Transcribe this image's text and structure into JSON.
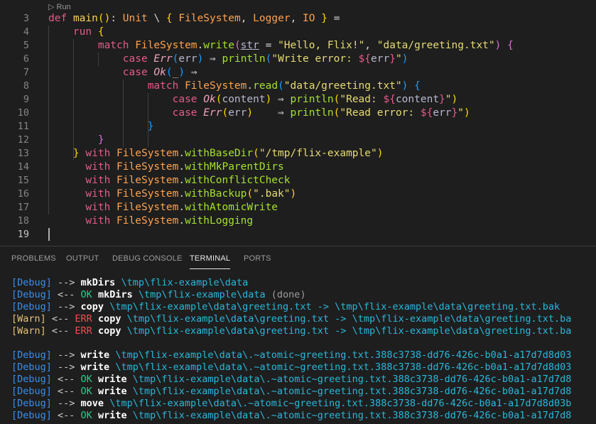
{
  "editor": {
    "codelens": "Run",
    "lines": [
      {
        "num": "3",
        "tokens": [
          [
            "def",
            "kw"
          ],
          [
            " ",
            "pl"
          ],
          [
            "main",
            "fn"
          ],
          [
            "()",
            "b1"
          ],
          [
            ": ",
            "pl"
          ],
          [
            "Unit",
            "ty"
          ],
          [
            " \\ ",
            "pl"
          ],
          [
            "{",
            "b1"
          ],
          [
            " ",
            "pl"
          ],
          [
            "FileSystem",
            "ty"
          ],
          [
            ", ",
            "pl"
          ],
          [
            "Logger",
            "ty"
          ],
          [
            ", ",
            "pl"
          ],
          [
            "IO",
            "ty"
          ],
          [
            " ",
            "pl"
          ],
          [
            "}",
            "b1"
          ],
          [
            " =",
            "pl"
          ]
        ]
      },
      {
        "num": "4",
        "tokens": [
          [
            "    ",
            "pl"
          ],
          [
            "run",
            "kw"
          ],
          [
            " ",
            "pl"
          ],
          [
            "{",
            "b1"
          ]
        ]
      },
      {
        "num": "5",
        "tokens": [
          [
            "        ",
            "pl"
          ],
          [
            "match",
            "kw"
          ],
          [
            " ",
            "pl"
          ],
          [
            "FileSystem",
            "ty"
          ],
          [
            ".",
            "pl"
          ],
          [
            "write",
            "md"
          ],
          [
            "(",
            "b2"
          ],
          [
            "str",
            "va ul"
          ],
          [
            " = ",
            "pl"
          ],
          [
            "\"Hello, Flix!\"",
            "st"
          ],
          [
            ", ",
            "pl"
          ],
          [
            "\"data/greeting.txt\"",
            "st"
          ],
          [
            ")",
            "b2"
          ],
          [
            " ",
            "pl"
          ],
          [
            "{",
            "b2"
          ]
        ]
      },
      {
        "num": "6",
        "tokens": [
          [
            "            ",
            "pl"
          ],
          [
            "case",
            "kw"
          ],
          [
            " ",
            "pl"
          ],
          [
            "Err",
            "en"
          ],
          [
            "(",
            "b3"
          ],
          [
            "err",
            "va"
          ],
          [
            ")",
            "b3"
          ],
          [
            " ⇒ ",
            "pl"
          ],
          [
            "println",
            "md"
          ],
          [
            "(",
            "b3"
          ],
          [
            "\"Write error: ",
            "st"
          ],
          [
            "${",
            "ip"
          ],
          [
            "err",
            "va"
          ],
          [
            "}",
            "ip"
          ],
          [
            "\"",
            "st"
          ],
          [
            ")",
            "b3"
          ]
        ]
      },
      {
        "num": "7",
        "tokens": [
          [
            "            ",
            "pl"
          ],
          [
            "case",
            "kw"
          ],
          [
            " ",
            "pl"
          ],
          [
            "Ok",
            "en"
          ],
          [
            "(",
            "b3"
          ],
          [
            "_",
            "va"
          ],
          [
            ")",
            "b3"
          ],
          [
            " ⇒",
            "pl"
          ]
        ]
      },
      {
        "num": "8",
        "tokens": [
          [
            "                ",
            "pl"
          ],
          [
            "match",
            "kw"
          ],
          [
            " ",
            "pl"
          ],
          [
            "FileSystem",
            "ty"
          ],
          [
            ".",
            "pl"
          ],
          [
            "read",
            "md"
          ],
          [
            "(",
            "b3"
          ],
          [
            "\"data/greeting.txt\"",
            "st"
          ],
          [
            ")",
            "b3"
          ],
          [
            " ",
            "pl"
          ],
          [
            "{",
            "b3"
          ]
        ]
      },
      {
        "num": "9",
        "tokens": [
          [
            "                    ",
            "pl"
          ],
          [
            "case",
            "kw"
          ],
          [
            " ",
            "pl"
          ],
          [
            "Ok",
            "en"
          ],
          [
            "(",
            "b1"
          ],
          [
            "content",
            "va"
          ],
          [
            ")",
            "b1"
          ],
          [
            " ⇒ ",
            "pl"
          ],
          [
            "println",
            "md"
          ],
          [
            "(",
            "b1"
          ],
          [
            "\"Read: ",
            "st"
          ],
          [
            "${",
            "ip"
          ],
          [
            "content",
            "va"
          ],
          [
            "}",
            "ip"
          ],
          [
            "\"",
            "st"
          ],
          [
            ")",
            "b1"
          ]
        ]
      },
      {
        "num": "10",
        "tokens": [
          [
            "                    ",
            "pl"
          ],
          [
            "case",
            "kw"
          ],
          [
            " ",
            "pl"
          ],
          [
            "Err",
            "en"
          ],
          [
            "(",
            "b1"
          ],
          [
            "err",
            "va"
          ],
          [
            ")",
            "b1"
          ],
          [
            "    ⇒ ",
            "pl"
          ],
          [
            "println",
            "md"
          ],
          [
            "(",
            "b1"
          ],
          [
            "\"Read error: ",
            "st"
          ],
          [
            "${",
            "ip"
          ],
          [
            "err",
            "va"
          ],
          [
            "}",
            "ip"
          ],
          [
            "\"",
            "st"
          ],
          [
            ")",
            "b1"
          ]
        ]
      },
      {
        "num": "11",
        "tokens": [
          [
            "                ",
            "pl"
          ],
          [
            "}",
            "b3"
          ]
        ]
      },
      {
        "num": "12",
        "tokens": [
          [
            "        ",
            "pl"
          ],
          [
            "}",
            "b2"
          ]
        ]
      },
      {
        "num": "13",
        "tokens": [
          [
            "    ",
            "pl"
          ],
          [
            "}",
            "b1"
          ],
          [
            " ",
            "pl"
          ],
          [
            "with",
            "kw"
          ],
          [
            " ",
            "pl"
          ],
          [
            "FileSystem",
            "ty"
          ],
          [
            ".",
            "pl"
          ],
          [
            "withBaseDir",
            "md"
          ],
          [
            "(",
            "b1"
          ],
          [
            "\"/tmp/flix-example\"",
            "st"
          ],
          [
            ")",
            "b1"
          ]
        ]
      },
      {
        "num": "14",
        "tokens": [
          [
            "      ",
            "pl"
          ],
          [
            "with",
            "kw"
          ],
          [
            " ",
            "pl"
          ],
          [
            "FileSystem",
            "ty"
          ],
          [
            ".",
            "pl"
          ],
          [
            "withMkParentDirs",
            "md"
          ]
        ]
      },
      {
        "num": "15",
        "tokens": [
          [
            "      ",
            "pl"
          ],
          [
            "with",
            "kw"
          ],
          [
            " ",
            "pl"
          ],
          [
            "FileSystem",
            "ty"
          ],
          [
            ".",
            "pl"
          ],
          [
            "withConflictCheck",
            "md"
          ]
        ]
      },
      {
        "num": "16",
        "tokens": [
          [
            "      ",
            "pl"
          ],
          [
            "with",
            "kw"
          ],
          [
            " ",
            "pl"
          ],
          [
            "FileSystem",
            "ty"
          ],
          [
            ".",
            "pl"
          ],
          [
            "withBackup",
            "md"
          ],
          [
            "(",
            "b1"
          ],
          [
            "\".bak\"",
            "st"
          ],
          [
            ")",
            "b1"
          ]
        ]
      },
      {
        "num": "17",
        "tokens": [
          [
            "      ",
            "pl"
          ],
          [
            "with",
            "kw"
          ],
          [
            " ",
            "pl"
          ],
          [
            "FileSystem",
            "ty"
          ],
          [
            ".",
            "pl"
          ],
          [
            "withAtomicWrite",
            "md"
          ]
        ]
      },
      {
        "num": "18",
        "tokens": [
          [
            "      ",
            "pl"
          ],
          [
            "with",
            "kw"
          ],
          [
            " ",
            "pl"
          ],
          [
            "FileSystem",
            "ty"
          ],
          [
            ".",
            "pl"
          ],
          [
            "withLogging",
            "md"
          ]
        ]
      },
      {
        "num": "19",
        "tokens": []
      }
    ]
  },
  "panel": {
    "tabs": [
      "PROBLEMS",
      "OUTPUT",
      "DEBUG CONSOLE",
      "TERMINAL",
      "PORTS"
    ],
    "active_tab": "TERMINAL",
    "terminal": [
      [
        [
          "[Debug]",
          "tdbg"
        ],
        [
          " --> ",
          "tgt"
        ],
        [
          "mkDirs",
          "top"
        ],
        [
          " \\tmp\\flix-example\\data",
          "tpath"
        ]
      ],
      [
        [
          "[Debug]",
          "tdbg"
        ],
        [
          " <-- ",
          "tgt"
        ],
        [
          "OK",
          "tok"
        ],
        [
          " ",
          "tgt"
        ],
        [
          "mkDirs",
          "top"
        ],
        [
          " \\tmp\\flix-example\\data",
          "tpath"
        ],
        [
          " (done)",
          "tdone"
        ]
      ],
      [
        [
          "[Debug]",
          "tdbg"
        ],
        [
          " --> ",
          "tgt"
        ],
        [
          "copy",
          "top"
        ],
        [
          " \\tmp\\flix-example\\data\\greeting.txt -> \\tmp\\flix-example\\data\\greeting.txt.bak",
          "tpath"
        ]
      ],
      [
        [
          "[Warn]",
          "twarn"
        ],
        [
          " <-- ",
          "tgt"
        ],
        [
          "ERR",
          "terr"
        ],
        [
          " ",
          "tgt"
        ],
        [
          "copy",
          "top"
        ],
        [
          " \\tmp\\flix-example\\data\\greeting.txt -> \\tmp\\flix-example\\data\\greeting.txt.ba",
          "tpath"
        ]
      ],
      [
        [
          "[Warn]",
          "twarn"
        ],
        [
          " <-- ",
          "tgt"
        ],
        [
          "ERR",
          "terr"
        ],
        [
          " ",
          "tgt"
        ],
        [
          "copy",
          "top"
        ],
        [
          " \\tmp\\flix-example\\data\\greeting.txt -> \\tmp\\flix-example\\data\\greeting.txt.ba",
          "tpath"
        ]
      ],
      [],
      [
        [
          "[Debug]",
          "tdbg"
        ],
        [
          " --> ",
          "tgt"
        ],
        [
          "write",
          "top"
        ],
        [
          " \\tmp\\flix-example\\data\\.~atomic~greeting.txt.388c3738-dd76-426c-b0a1-a17d7d8d03",
          "tpath"
        ]
      ],
      [
        [
          "[Debug]",
          "tdbg"
        ],
        [
          " --> ",
          "tgt"
        ],
        [
          "write",
          "top"
        ],
        [
          " \\tmp\\flix-example\\data\\.~atomic~greeting.txt.388c3738-dd76-426c-b0a1-a17d7d8d03",
          "tpath"
        ]
      ],
      [
        [
          "[Debug]",
          "tdbg"
        ],
        [
          " <-- ",
          "tgt"
        ],
        [
          "OK",
          "tok"
        ],
        [
          " ",
          "tgt"
        ],
        [
          "write",
          "top"
        ],
        [
          " \\tmp\\flix-example\\data\\.~atomic~greeting.txt.388c3738-dd76-426c-b0a1-a17d7d8",
          "tpath"
        ]
      ],
      [
        [
          "[Debug]",
          "tdbg"
        ],
        [
          " <-- ",
          "tgt"
        ],
        [
          "OK",
          "tok"
        ],
        [
          " ",
          "tgt"
        ],
        [
          "write",
          "top"
        ],
        [
          " \\tmp\\flix-example\\data\\.~atomic~greeting.txt.388c3738-dd76-426c-b0a1-a17d7d8",
          "tpath"
        ]
      ],
      [
        [
          "[Debug]",
          "tdbg"
        ],
        [
          " --> ",
          "tgt"
        ],
        [
          "move",
          "top"
        ],
        [
          " \\tmp\\flix-example\\data\\.~atomic~greeting.txt.388c3738-dd76-426c-b0a1-a17d7d8d03b",
          "tpath"
        ]
      ],
      [
        [
          "[Debug]",
          "tdbg"
        ],
        [
          " <-- ",
          "tgt"
        ],
        [
          "OK",
          "tok"
        ],
        [
          " ",
          "tgt"
        ],
        [
          "write",
          "top"
        ],
        [
          " \\tmp\\flix-example\\data\\.~atomic~greeting.txt.388c3738-dd76-426c-b0a1-a17d7d8",
          "tpath"
        ]
      ]
    ]
  }
}
